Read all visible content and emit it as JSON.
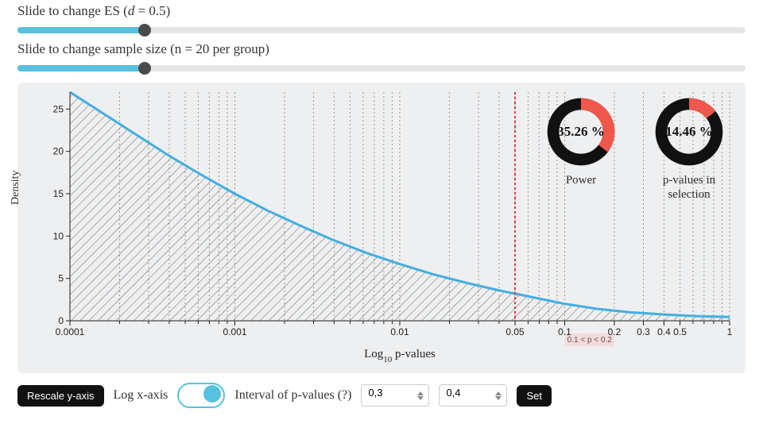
{
  "sliders": {
    "es": {
      "label_pre": "Slide to change ES (",
      "var": "d",
      "eq": " = 0.5)",
      "pct": 17.5
    },
    "n": {
      "label_pre": "Slide to change sample size (n = 20 per group)",
      "pct": 17.5
    }
  },
  "chart_data": {
    "type": "line",
    "title": "",
    "xlabel": "Log10 p-values",
    "ylabel": "Density",
    "x_scale": "log10",
    "xlim": [
      0.0001,
      1
    ],
    "ylim": [
      0,
      27
    ],
    "y_ticks": [
      0,
      5,
      10,
      15,
      20,
      25
    ],
    "x_ticks_major": [
      0.0001,
      0.001,
      0.01,
      0.05,
      0.1,
      0.2,
      0.3,
      0.4,
      0.5,
      1
    ],
    "x_tick_labels": [
      "0.0001",
      "0.001",
      "0.01",
      "0.05",
      "0.1",
      "0.2",
      "0.3",
      "0.4",
      "0.5",
      "1"
    ],
    "curve_points_logx_y": [
      [
        -4.0,
        27.0
      ],
      [
        -3.8,
        24.5
      ],
      [
        -3.6,
        22.0
      ],
      [
        -3.4,
        19.5
      ],
      [
        -3.2,
        17.2
      ],
      [
        -3.0,
        15.0
      ],
      [
        -2.8,
        13.0
      ],
      [
        -2.6,
        11.2
      ],
      [
        -2.4,
        9.5
      ],
      [
        -2.2,
        8.0
      ],
      [
        -2.0,
        6.7
      ],
      [
        -1.8,
        5.5
      ],
      [
        -1.6,
        4.5
      ],
      [
        -1.4,
        3.6
      ],
      [
        -1.301,
        3.2
      ],
      [
        -1.2,
        2.8
      ],
      [
        -1.0,
        2.0
      ],
      [
        -0.8,
        1.4
      ],
      [
        -0.699,
        1.2
      ],
      [
        -0.6,
        1.0
      ],
      [
        -0.4,
        0.75
      ],
      [
        -0.301,
        0.65
      ],
      [
        -0.2,
        0.55
      ],
      [
        -0.1,
        0.5
      ],
      [
        0.0,
        0.45
      ]
    ],
    "vline": {
      "x": 0.05,
      "label": ""
    },
    "shaded_interval": {
      "x0": 0.1,
      "x1": 0.2,
      "label": "0.1 < p < 0.2"
    }
  },
  "donuts": {
    "power": {
      "value_text": "35.26 %",
      "fraction": 0.3526,
      "caption": "Power"
    },
    "psel": {
      "value_text": "14.46 %",
      "fraction": 0.1446,
      "caption": "p-values in selection"
    }
  },
  "toolbar": {
    "rescale_label": "Rescale y-axis",
    "logx_label": "Log x-axis",
    "logx_on": true,
    "interval_label": "Interval of p-values (?)",
    "p_low": "0,3",
    "p_high": "0,4",
    "set_label": "Set"
  }
}
